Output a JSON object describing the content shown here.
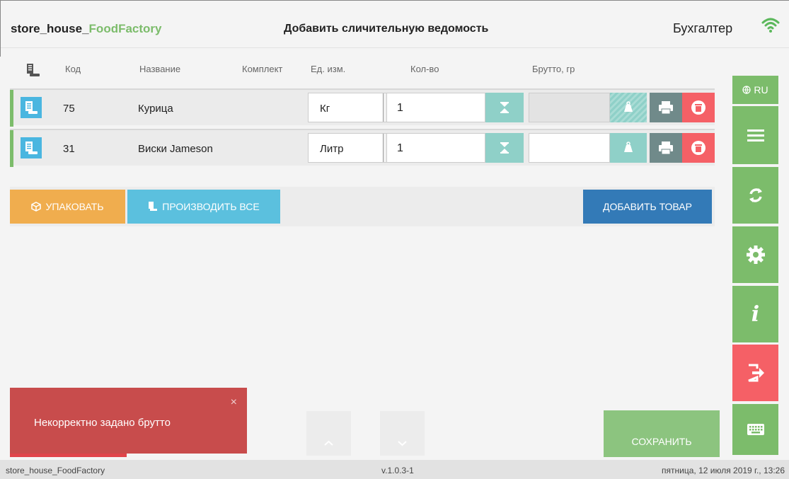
{
  "header": {
    "app_name_prefix": "store_house_",
    "app_name_suffix": "FoodFactory",
    "page_title": "Добавить сличительную ведомость",
    "user_role": "Бухгалтер"
  },
  "table": {
    "columns": [
      "Код",
      "Название",
      "Комплект",
      "Ед. изм.",
      "Кол-во",
      "Брутто, гр"
    ],
    "rows": [
      {
        "code": "75",
        "name": "Курица",
        "unit": "Кг",
        "qty": "1",
        "brutto": ""
      },
      {
        "code": "31",
        "name": "Виски Jameson",
        "unit": "Литр",
        "qty": "1",
        "brutto": ""
      }
    ]
  },
  "actions": {
    "pack_label": "УПАКОВАТЬ",
    "produce_all_label": "ПРОИЗВОДИТЬ ВСЕ",
    "add_item_label": "ДОБАВИТЬ ТОВАР",
    "save_label": "СОХРАНИТЬ"
  },
  "sidebar": {
    "lang_label": "RU",
    "info_label": "i"
  },
  "toast": {
    "message": "Некорректно задано брутто",
    "close_label": "×"
  },
  "footer": {
    "app": "store_house_FoodFactory",
    "version": "v.1.0.3-1",
    "datetime": "пятница, 12 июля 2019 г., 13:26"
  },
  "colors": {
    "green": "#7cbc6b",
    "blue": "#4ab6e0",
    "orange": "#f0ad4e",
    "dark_blue": "#337ab7",
    "red": "#f56066",
    "teal": "#8fd0c8"
  }
}
